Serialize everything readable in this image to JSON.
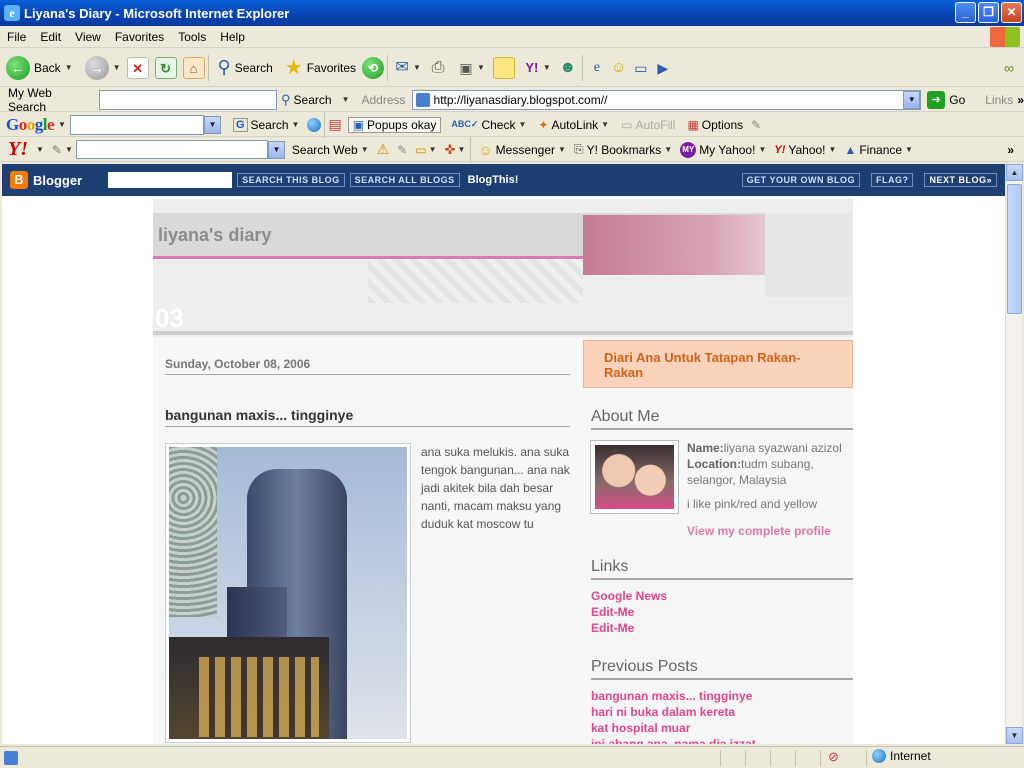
{
  "window": {
    "title": "Liyana's Diary - Microsoft Internet Explorer"
  },
  "menu": [
    "File",
    "Edit",
    "View",
    "Favorites",
    "Tools",
    "Help"
  ],
  "toolbar": {
    "back": "Back",
    "search": "Search",
    "favorites": "Favorites"
  },
  "searchbar": {
    "label": "My Web Search",
    "search_btn": "Search",
    "address_label": "Address",
    "url": "http://liyanasdiary.blogspot.com//",
    "go": "Go",
    "links": "Links"
  },
  "google": {
    "search": "Search",
    "popups": "Popups okay",
    "check": "Check",
    "autolink": "AutoLink",
    "autofill": "AutoFill",
    "options": "Options"
  },
  "yahoo": {
    "search_web": "Search Web",
    "messenger": "Messenger",
    "bookmarks": "Y! Bookmarks",
    "my_yahoo": "My Yahoo!",
    "yahoo": "Yahoo!",
    "finance": "Finance"
  },
  "blogger": {
    "logo": "Blogger",
    "search_this": "SEARCH THIS BLOG",
    "search_all": "SEARCH ALL BLOGS",
    "blogthis": "BlogThis!",
    "get_own": "GET YOUR OWN BLOG",
    "flag": "FLAG?",
    "next": "NEXT BLOG»"
  },
  "blog": {
    "title": "liyana's diary",
    "description": "Diari Ana Untuk Tatapan Rakan-Rakan",
    "date": "Sunday, October 08, 2006",
    "post_title": "bangunan maxis... tingginye",
    "post_text": "ana suka melukis. ana suka tengok bangunan... ana nak jadi akitek bila dah besar nanti, macam maksu yang duduk kat moscow tu"
  },
  "sidebar": {
    "about_head": "About Me",
    "name_label": "Name:",
    "name": "liyana syazwani azizol",
    "location_label": "Location:",
    "location": "tudm subang, selangor, Malaysia",
    "likes": "i like pink/red and yellow",
    "profile_link": "View my complete profile",
    "links_head": "Links",
    "links": [
      "Google News",
      "Edit-Me",
      "Edit-Me"
    ],
    "prev_head": "Previous Posts",
    "prev_posts": [
      "bangunan maxis... tingginye",
      "hari ni buka dalam kereta",
      "kat hospital muar",
      "ini abang ana, nama dia izzat"
    ]
  },
  "status": {
    "zone": "Internet"
  }
}
